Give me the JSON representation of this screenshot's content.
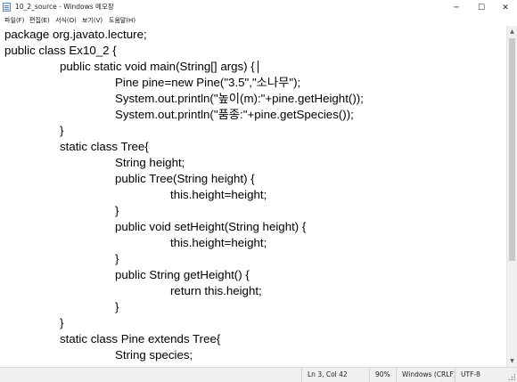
{
  "window": {
    "title": "10_2_source - Windows 메모장",
    "controls": {
      "minimize_glyph": "─",
      "maximize_glyph": "☐",
      "close_glyph": "✕"
    }
  },
  "menu": {
    "items": [
      {
        "label": "파일(F)"
      },
      {
        "label": "편집(E)"
      },
      {
        "label": "서식(O)"
      },
      {
        "label": "보기(V)"
      },
      {
        "label": "도움말(H)"
      }
    ]
  },
  "editor": {
    "lines": [
      {
        "text": "package org.javato.lecture;"
      },
      {
        "text": "public class Ex10_2 {"
      },
      {
        "text": "public static void main(String[] args) {"
      },
      {
        "text": "Pine pine=new Pine(\"3.5\",\"소나무\");"
      },
      {
        "text": "System.out.println(\"높이(m):\"+pine.getHeight());"
      },
      {
        "text": "System.out.println(\"품종:\"+pine.getSpecies());"
      },
      {
        "text": "}"
      },
      {
        "text": "static class Tree{"
      },
      {
        "text": "String height;"
      },
      {
        "text": "public Tree(String height) {"
      },
      {
        "text": "this.height=height;"
      },
      {
        "text": "}"
      },
      {
        "text": "public void setHeight(String height) {"
      },
      {
        "text": "this.height=height;"
      },
      {
        "text": "}"
      },
      {
        "text": "public String getHeight() {"
      },
      {
        "text": "return this.height;"
      },
      {
        "text": "}"
      },
      {
        "text": "}"
      },
      {
        "text": "static class Pine extends Tree{"
      },
      {
        "text": "String species;"
      }
    ]
  },
  "scrollbar": {
    "up_glyph": "▲",
    "down_glyph": "▼"
  },
  "status": {
    "position": "Ln 3, Col 42",
    "zoom": "90%",
    "line_ending": "Windows (CRLF)",
    "encoding": "UTF-8"
  }
}
